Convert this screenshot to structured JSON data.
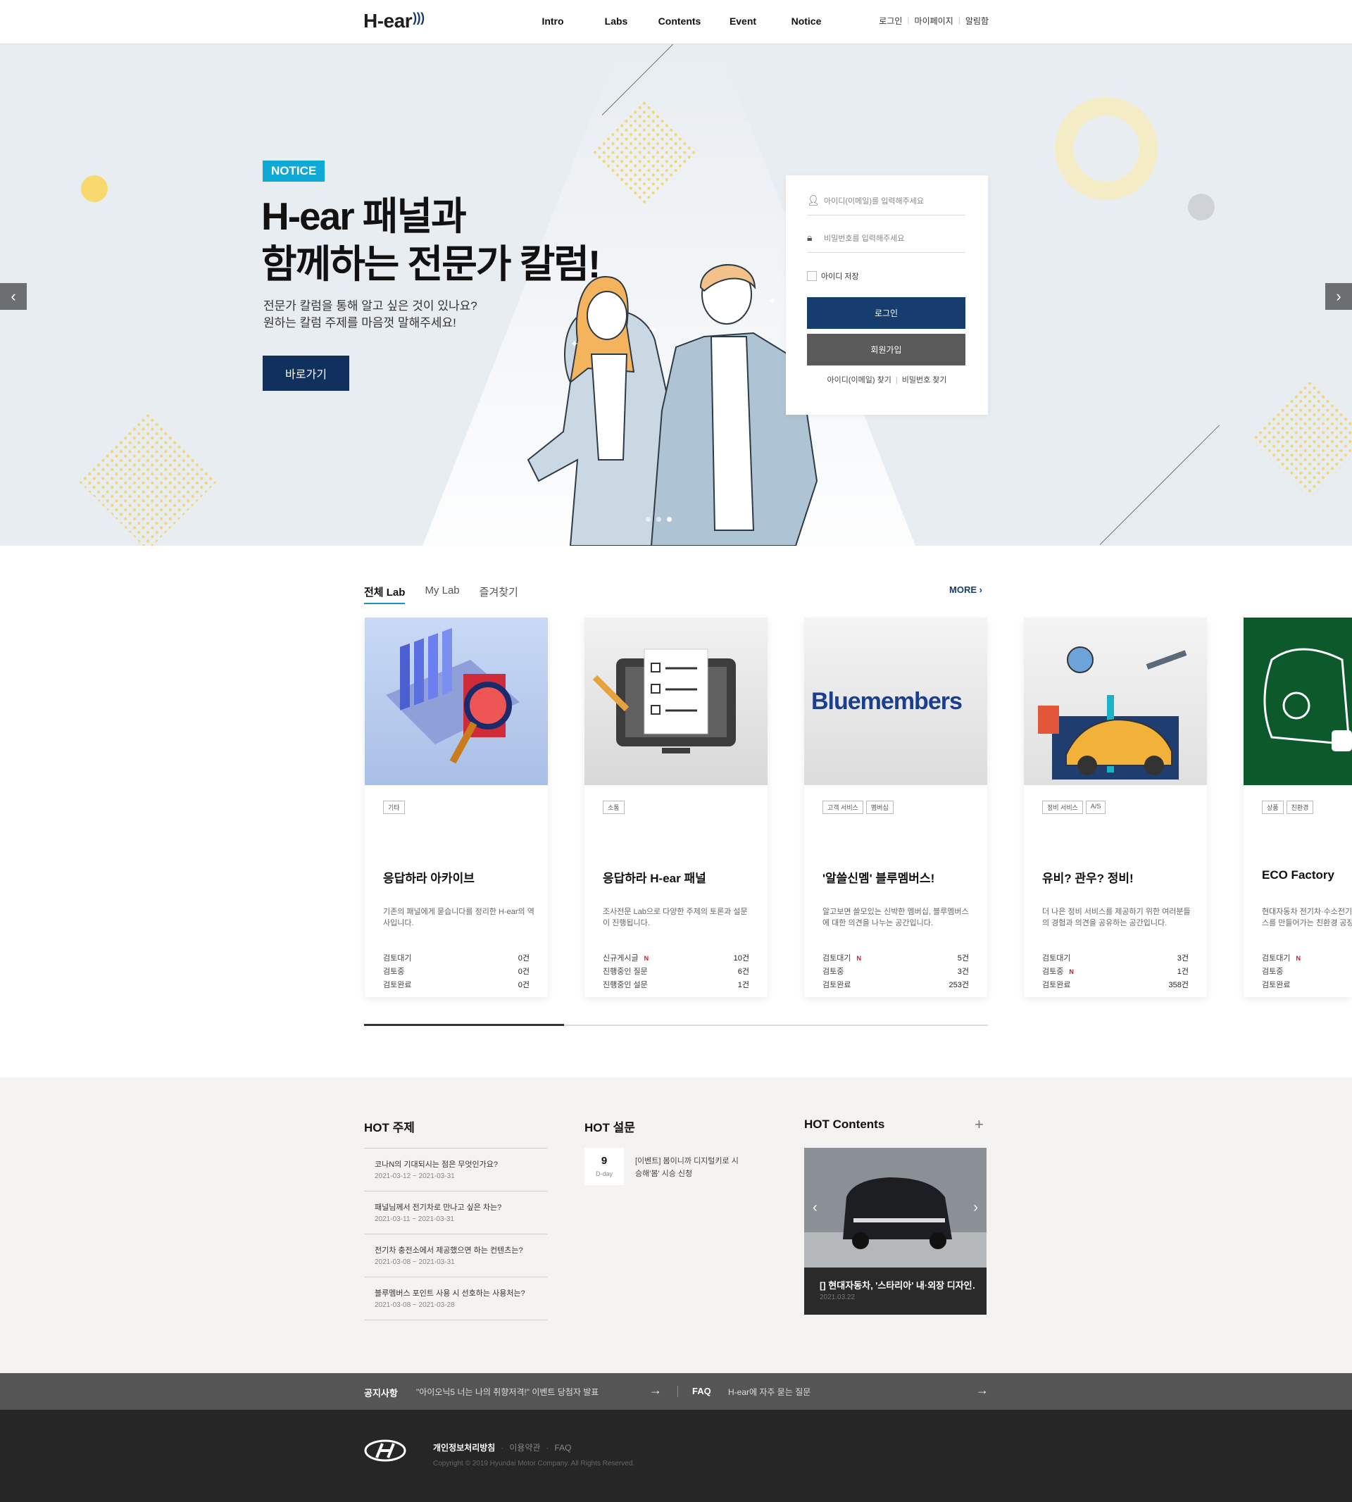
{
  "header": {
    "logo": "H-ear",
    "nav": [
      "Intro",
      "Labs",
      "Contents",
      "Event",
      "Notice"
    ],
    "util": [
      "로그인",
      "마이페이지",
      "알림함"
    ]
  },
  "hero": {
    "badge": "NOTICE",
    "title_line1": "H-ear 패널과",
    "title_line2": "함께하는 전문가 칼럼!",
    "sub_line1": "전문가 칼럼을 통해 알고 싶은 것이 있나요?",
    "sub_line2": "원하는 칼럼 주제를 마음껏 말해주세요!",
    "button": "바로가기",
    "slide_count": 3,
    "active_slide": 3
  },
  "login": {
    "id_placeholder": "아이디(이메일)를 입력해주세요",
    "pw_placeholder": "비밀번호를 입력해주세요",
    "save_id": "아이디 저장",
    "login_button": "로그인",
    "join_button": "회원가입",
    "find_id": "아이디(이메일) 찾기",
    "find_pw": "비밀번호 찾기"
  },
  "labs": {
    "tabs": [
      "전체 Lab",
      "My Lab",
      "즐겨찾기"
    ],
    "more": "MORE",
    "progress": 0.32,
    "cards": [
      {
        "tags": [
          "기타"
        ],
        "title": "응답하라 아카이브",
        "desc": "기존의 패널에게 묻습니다를 정리한 H-ear의 역사입니다.",
        "stats": [
          {
            "label": "검토대기",
            "new": "",
            "value": "0건"
          },
          {
            "label": "검토중",
            "new": "",
            "value": "0건"
          },
          {
            "label": "검토완료",
            "new": "",
            "value": "0건"
          }
        ]
      },
      {
        "tags": [
          "소통"
        ],
        "title": "응답하라 H-ear 패널",
        "desc": "조사전문 Lab으로 다양한 주제의 토론과 설문이 진행됩니다.",
        "stats": [
          {
            "label": "신규게시글",
            "new": "N",
            "value": "10건"
          },
          {
            "label": "진행중인 질문",
            "new": "",
            "value": "6건"
          },
          {
            "label": "진행중인 설문",
            "new": "",
            "value": "1건"
          }
        ]
      },
      {
        "tags": [
          "고객 서비스",
          "멤버십"
        ],
        "title": "'알쓸신멤' 블루멤버스!",
        "desc": "알고보면 쓸모있는 신박한 멤버십, 블루멤버스에 대한 의견을 나누는 공간입니다.",
        "thumb_text": "Bluemembers",
        "stats": [
          {
            "label": "검토대기",
            "new": "N",
            "value": "5건"
          },
          {
            "label": "검토중",
            "new": "",
            "value": "3건"
          },
          {
            "label": "검토완료",
            "new": "",
            "value": "253건"
          }
        ]
      },
      {
        "tags": [
          "정비 서비스",
          "A/S"
        ],
        "title": "유비? 관우? 정비!",
        "desc": "더 나은 정비 서비스를 제공하기 위한 여러분들의 경험과 의견을 공유하는 공간입니다.",
        "stats": [
          {
            "label": "검토대기",
            "new": "",
            "value": "3건"
          },
          {
            "label": "검토중",
            "new": "N",
            "value": "1건"
          },
          {
            "label": "검토완료",
            "new": "",
            "value": "358건"
          }
        ]
      },
      {
        "tags": [
          "상품",
          "친환경"
        ],
        "title": "ECO Factory",
        "desc": "현대자동차 전기차·수소전기차 상품과 서비스를 만들어가는 친환경 공장",
        "stats": [
          {
            "label": "검토대기",
            "new": "N",
            "value": ""
          },
          {
            "label": "검토중",
            "new": "",
            "value": ""
          },
          {
            "label": "검토완료",
            "new": "",
            "value": ""
          }
        ]
      }
    ]
  },
  "hot": {
    "topic_title": "HOT 주제",
    "topics": [
      {
        "q": "코나N의 기대되시는 점은 무엇인가요?",
        "d": "2021-03-12 ~ 2021-03-31"
      },
      {
        "q": "패널님께서 전기차로 만나고 싶은 차는?",
        "d": "2021-03-11 ~ 2021-03-31"
      },
      {
        "q": "전기차 충전소에서 제공했으면 하는 컨텐츠는?",
        "d": "2021-03-08 ~ 2021-03-31"
      },
      {
        "q": "블루멤버스 포인트 사용 시 선호하는 사용처는?",
        "d": "2021-03-08 ~ 2021-03-28"
      }
    ],
    "survey_title": "HOT 설문",
    "survey": {
      "dday": "9",
      "dday_label": "D-day",
      "text": "[이벤트] 봄이니까 디지털키로 시승해'봄' 시승 신청"
    },
    "contents_title": "HOT Contents",
    "contents": {
      "caption": "[] 현대자동차, '스타리아' 내·외장 디자인…",
      "date": "2021.03.22"
    }
  },
  "notice_bar": {
    "notice_label": "공지사항",
    "notice_text": "\"아이오닉5 너는 나의 취향저격!\" 이벤트 당첨자 발표",
    "faq_label": "FAQ",
    "faq_text": "H-ear에 자주 묻는 질문"
  },
  "footer": {
    "privacy": "개인정보처리방침",
    "terms": "이용약관",
    "faq": "FAQ",
    "copyright": "Copyright © 2019 Hyundai Motor Company. All Rights Reserved."
  },
  "colors": {
    "navy": "#10305d",
    "notice_badge": "#0eaad5",
    "hero_bg": "#e8edf1",
    "hot_bg": "#f5f3f1"
  }
}
